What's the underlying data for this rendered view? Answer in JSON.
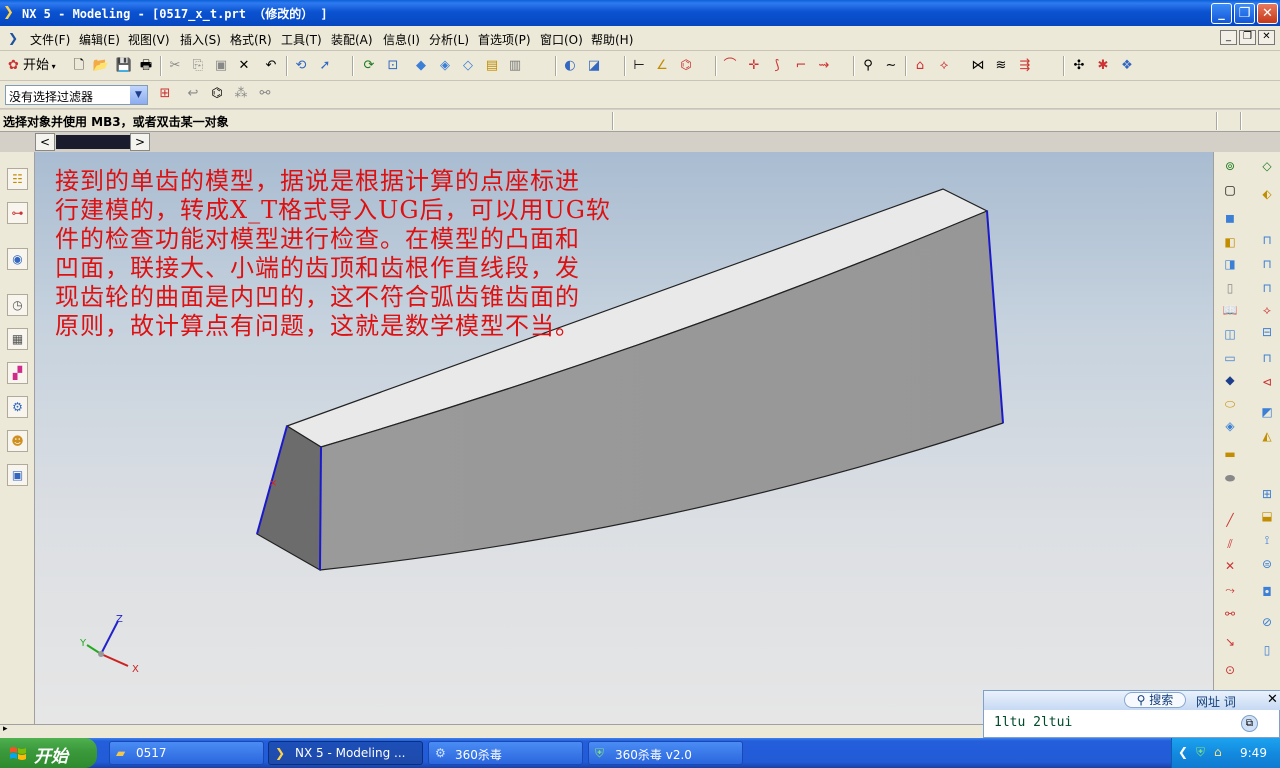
{
  "window": {
    "title": "NX 5 - Modeling - [0517_x_t.prt （修改的） ]",
    "controls": [
      "minimize",
      "restore",
      "close"
    ]
  },
  "menubar": {
    "items": [
      "文件(F)",
      "编辑(E)",
      "视图(V)",
      "插入(S)",
      "格式(R)",
      "工具(T)",
      "装配(A)",
      "信息(I)",
      "分析(L)",
      "首选项(P)",
      "窗口(O)",
      "帮助(H)"
    ]
  },
  "toolbar": {
    "start_label": "开始"
  },
  "selection_filter": {
    "value": "没有选择过滤器"
  },
  "status": {
    "message": "选择对象并使用 MB3，或者双击某一对象"
  },
  "annotation": {
    "lines": [
      "接到的单齿的模型，据说是根据计算的点座标进",
      "行建模的，转成X_T格式导入UG后，可以用UG软",
      "件的检查功能对模型进行检查。在模型的凸面和",
      "凹面，联接大、小端的齿顶和齿根作直线段，发",
      "现齿轮的曲面是内凹的，这不符合弧齿锥齿面的",
      "原则，故计算点有问题，这就是数学模型不当。"
    ]
  },
  "triad": {
    "z": "Z",
    "y": "Y",
    "x": "X"
  },
  "ime": {
    "search_label": "搜索",
    "nav_label": "网址 词",
    "input_text": "1ltu 2ltui"
  },
  "taskbar": {
    "start": "开始",
    "tasks": [
      {
        "label": "0517",
        "icon": "folder-icon"
      },
      {
        "label": "NX 5 - Modeling ...",
        "icon": "nx-icon"
      },
      {
        "label": "360杀毒",
        "icon": "antivirus-icon"
      },
      {
        "label": "360杀毒 v2.0",
        "icon": "shield-icon"
      }
    ],
    "clock": "9:49"
  },
  "colors": {
    "title_bar": "#0b53d1",
    "annotation_text": "#dd1111",
    "model_edge_highlight": "#1a1acc",
    "taskbar": "#245edb",
    "start_button": "#3c9a3c"
  }
}
